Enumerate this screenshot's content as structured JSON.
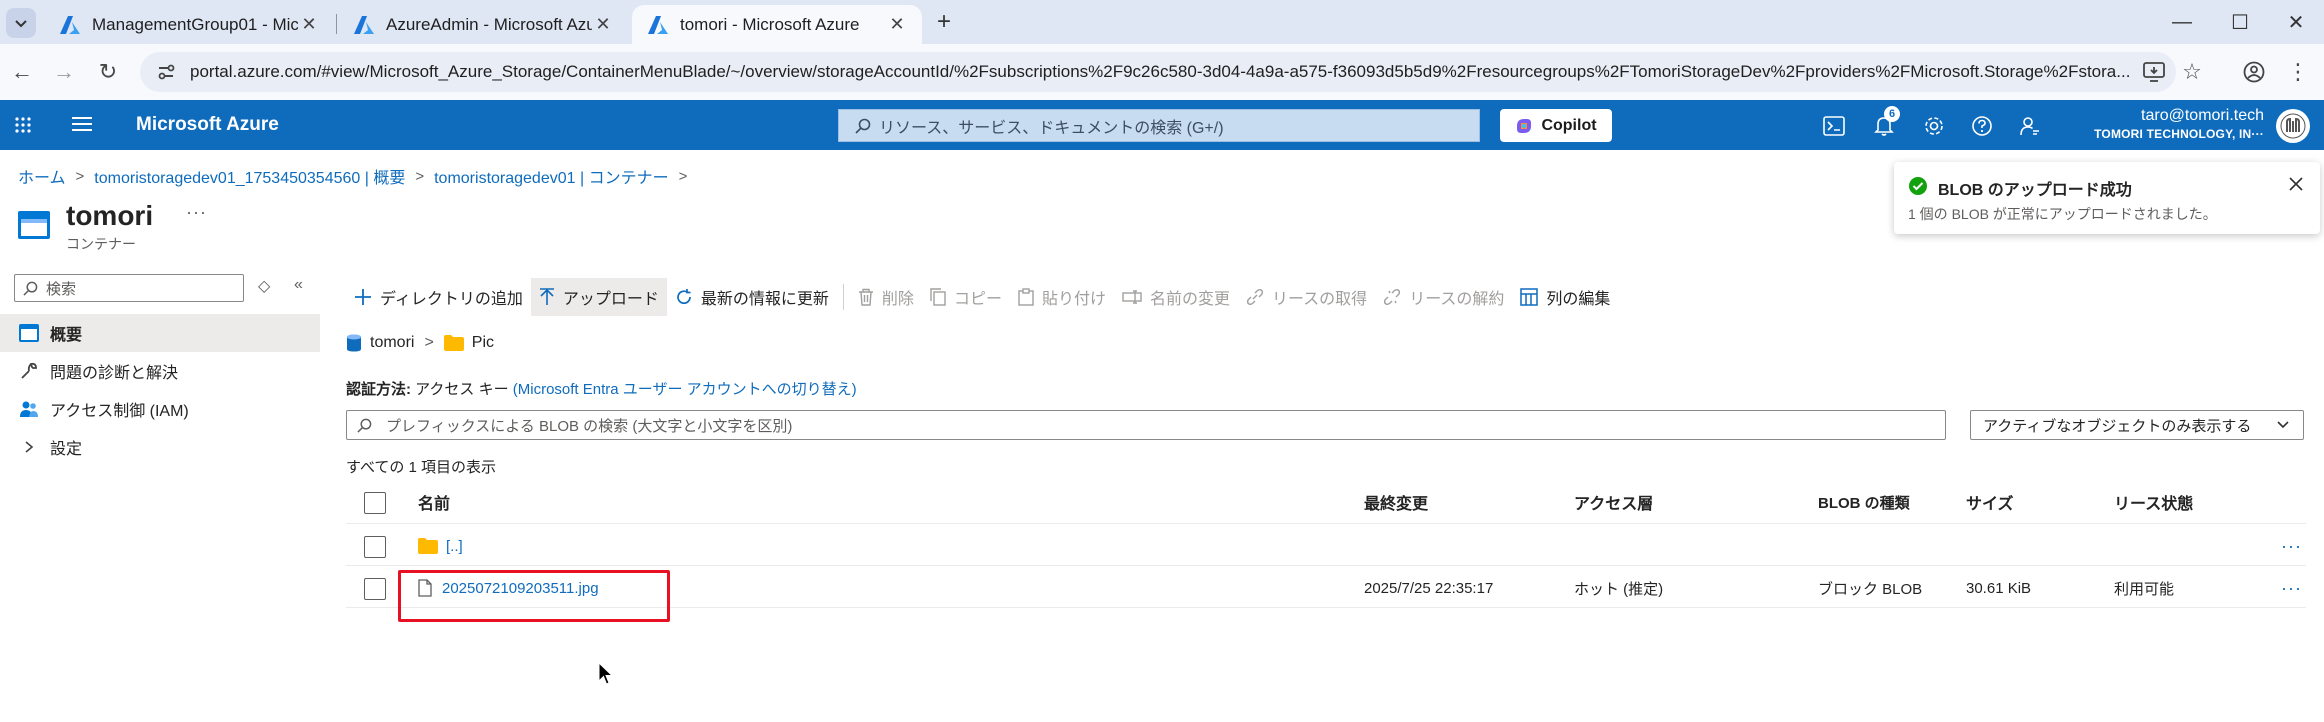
{
  "browser": {
    "tabs": [
      {
        "title": "ManagementGroup01 - Microsoft Azure",
        "active": false
      },
      {
        "title": "AzureAdmin - Microsoft Azure",
        "active": false
      },
      {
        "title": "tomori - Microsoft Azure",
        "active": true
      }
    ],
    "url": "portal.azure.com/#view/Microsoft_Azure_Storage/ContainerMenuBlade/~/overview/storageAccountId/%2Fsubscriptions%2F9c26c580-3d04-4a9a-a575-f36093d5b5d9%2Fresourcegroups%2FTomoriStorageDev%2Fproviders%2FMicrosoft.Storage%2Fstora..."
  },
  "header": {
    "brand": "Microsoft Azure",
    "search_placeholder": "リソース、サービス、ドキュメントの検索 (G+/)",
    "copilot_label": "Copilot",
    "notification_count": "6",
    "account_email": "taro@tomori.tech",
    "account_org": "TOMORI TECHNOLOGY, IN···",
    "brand_color": "#0f6cbd"
  },
  "breadcrumb": [
    "ホーム",
    "tomoristoragedev01_1753450354560 | 概要",
    "tomoristoragedev01 | コンテナー"
  ],
  "page": {
    "title": "tomori",
    "subtitle": "コンテナー",
    "more": "···"
  },
  "nav": {
    "search_placeholder": "検索",
    "items": [
      {
        "label": "概要",
        "icon": "overview-icon",
        "selected": true
      },
      {
        "label": "問題の診断と解決",
        "icon": "wrench-icon",
        "selected": false
      },
      {
        "label": "アクセス制御 (IAM)",
        "icon": "people-icon",
        "selected": false
      },
      {
        "label": "設定",
        "icon": "chevron-right-icon",
        "selected": false
      }
    ]
  },
  "toolbar": {
    "add_directory": "ディレクトリの追加",
    "upload": "アップロード",
    "refresh": "最新の情報に更新",
    "delete": "削除",
    "copy": "コピー",
    "paste": "貼り付け",
    "rename": "名前の変更",
    "acquire_lease": "リースの取得",
    "break_lease": "リースの解約",
    "edit_columns": "列の編集"
  },
  "path": {
    "container": "tomori",
    "folder": "Pic"
  },
  "auth": {
    "label": "認証方法:",
    "value": "アクセス キー",
    "link": "(Microsoft Entra ユーザー アカウントへの切り替え)"
  },
  "blob_search_placeholder": "プレフィックスによる BLOB の検索 (大文字と小文字を区別)",
  "filter_selected": "アクティブなオブジェクトのみ表示する",
  "item_count": "すべての 1 項目の表示",
  "table": {
    "columns": [
      "名前",
      "最終変更",
      "アクセス層",
      "BLOB の種類",
      "サイズ",
      "リース状態"
    ],
    "parent_row": "[..]",
    "rows": [
      {
        "name": "2025072109203511.jpg",
        "modified": "2025/7/25 22:35:17",
        "tier": "ホット (推定)",
        "type": "ブロック BLOB",
        "size": "30.61 KiB",
        "lease": "利用可能"
      }
    ]
  },
  "toast": {
    "title": "BLOB のアップロード成功",
    "body": "1 個の BLOB が正常にアップロードされました。",
    "success_color": "#13a10e"
  },
  "highlight_color": "#e81123"
}
